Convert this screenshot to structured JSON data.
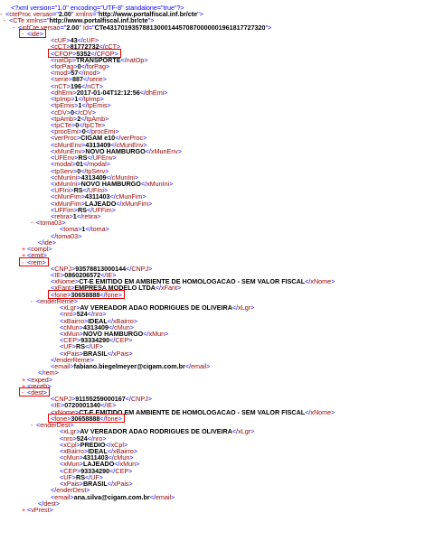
{
  "xml": {
    "lines": [
      {
        "k": "pi",
        "t": "<?xml version=\"1.0\" encoding=\"UTF-8\" standalone=\"true\"?>"
      },
      {
        "k": "open",
        "tog": "-",
        "name": "cteProc",
        "attrs": [
          [
            "versao",
            "2.00"
          ],
          [
            "xmlns",
            "http://www.portalfiscal.inf.br/cte"
          ]
        ]
      },
      {
        "k": "open",
        "tog": "-",
        "name": "CTe",
        "attrs": [
          [
            "xmlns",
            "http://www.portalfiscal.inf.br/cte"
          ]
        ]
      },
      {
        "k": "open",
        "tog": "-",
        "name": "infCte",
        "attrs": [
          [
            "versao",
            "2.00"
          ],
          [
            "Id",
            "CTe43170193578813000144570870000001961817727320"
          ]
        ]
      },
      {
        "k": "open",
        "tog": "-",
        "name": "ide"
      },
      {
        "k": "el",
        "name": "cUF",
        "v": "43"
      },
      {
        "k": "el",
        "name": "cCT",
        "v": "81772732"
      },
      {
        "k": "el",
        "name": "CFOP",
        "v": "5352"
      },
      {
        "k": "el",
        "name": "natOp",
        "v": "TRANSPORTE"
      },
      {
        "k": "el",
        "name": "forPag",
        "v": "0"
      },
      {
        "k": "el",
        "name": "mod",
        "v": "57"
      },
      {
        "k": "el",
        "name": "serie",
        "v": "887"
      },
      {
        "k": "el",
        "name": "nCT",
        "v": "196"
      },
      {
        "k": "el",
        "name": "dhEmi",
        "v": "2017-01-04T12:12:56"
      },
      {
        "k": "el",
        "name": "tpImp",
        "v": "1"
      },
      {
        "k": "el",
        "name": "tpEmis",
        "v": "1"
      },
      {
        "k": "el",
        "name": "cDV",
        "v": "0"
      },
      {
        "k": "el",
        "name": "tpAmb",
        "v": "2"
      },
      {
        "k": "el",
        "name": "tpCTe",
        "v": "0"
      },
      {
        "k": "el",
        "name": "procEmi",
        "v": "0"
      },
      {
        "k": "el",
        "name": "verProc",
        "v": "CIGAM e10"
      },
      {
        "k": "el",
        "name": "cMunEnv",
        "v": "4313409"
      },
      {
        "k": "el",
        "name": "xMunEnv",
        "v": "NOVO HAMBURGO"
      },
      {
        "k": "el",
        "name": "UFEnv",
        "v": "RS"
      },
      {
        "k": "el",
        "name": "modal",
        "v": "01"
      },
      {
        "k": "el",
        "name": "tpServ",
        "v": "0"
      },
      {
        "k": "el",
        "name": "cMunIni",
        "v": "4313409"
      },
      {
        "k": "el",
        "name": "xMunIni",
        "v": "NOVO HAMBURGO"
      },
      {
        "k": "el",
        "name": "UFIni",
        "v": "RS"
      },
      {
        "k": "el",
        "name": "cMunFim",
        "v": "4311403"
      },
      {
        "k": "el",
        "name": "xMunFim",
        "v": "LAJEADO"
      },
      {
        "k": "el",
        "name": "UFFim",
        "v": "RS"
      },
      {
        "k": "el",
        "name": "retira",
        "v": "1"
      },
      {
        "k": "open",
        "tog": "-",
        "name": "toma03"
      },
      {
        "k": "el",
        "name": "toma",
        "v": "1"
      },
      {
        "k": "close",
        "name": "toma03"
      },
      {
        "k": "close",
        "name": "ide"
      },
      {
        "k": "open",
        "tog": "+",
        "name": "compl"
      },
      {
        "k": "open",
        "tog": "+",
        "name": "emit"
      },
      {
        "k": "open",
        "tog": "-",
        "name": "rem"
      },
      {
        "k": "el",
        "name": "CNPJ",
        "v": "93578813000144"
      },
      {
        "k": "el",
        "name": "IE",
        "v": "0860206572"
      },
      {
        "k": "el",
        "name": "xNome",
        "v": "CT-E EMITIDO EM AMBIENTE DE HOMOLOGACAO - SEM VALOR FISCAL"
      },
      {
        "k": "el",
        "name": "xFant",
        "v": "EMPRESA MODELO LTDA"
      },
      {
        "k": "el",
        "name": "fone",
        "v": "30658888"
      },
      {
        "k": "open",
        "tog": "-",
        "name": "enderReme"
      },
      {
        "k": "el",
        "name": "xLgr",
        "v": "AV VEREADOR ADAO RODRIGUES DE OLIVEIRA"
      },
      {
        "k": "el",
        "name": "nro",
        "v": "524"
      },
      {
        "k": "el",
        "name": "xBairro",
        "v": "IDEAL"
      },
      {
        "k": "el",
        "name": "cMun",
        "v": "4313409"
      },
      {
        "k": "el",
        "name": "xMun",
        "v": "NOVO HAMBURGO"
      },
      {
        "k": "el",
        "name": "CEP",
        "v": "93334290"
      },
      {
        "k": "el",
        "name": "UF",
        "v": "RS"
      },
      {
        "k": "el",
        "name": "xPais",
        "v": "BRASIL"
      },
      {
        "k": "close",
        "name": "enderReme"
      },
      {
        "k": "el",
        "name": "email",
        "v": "fabiano.biegelmeyer@cigam.com.br"
      },
      {
        "k": "close",
        "name": "rem"
      },
      {
        "k": "open",
        "tog": "+",
        "name": "exped"
      },
      {
        "k": "open",
        "tog": "+",
        "name": "receb"
      },
      {
        "k": "open",
        "tog": "-",
        "name": "dest"
      },
      {
        "k": "el",
        "name": "CNPJ",
        "v": "91155259000167"
      },
      {
        "k": "el",
        "name": "IE",
        "v": "0720001340"
      },
      {
        "k": "el",
        "name": "xNome",
        "v": "CT-E EMITIDO EM AMBIENTE DE HOMOLOGACAO - SEM VALOR FISCAL"
      },
      {
        "k": "el",
        "name": "fone",
        "v": "30658888"
      },
      {
        "k": "open",
        "tog": "-",
        "name": "enderDest"
      },
      {
        "k": "el",
        "name": "xLgr",
        "v": "AV VEREADOR ADAO RODRIGUES DE OLIVEIRA"
      },
      {
        "k": "el",
        "name": "nro",
        "v": "524"
      },
      {
        "k": "el",
        "name": "xCpl",
        "v": "PREDIO"
      },
      {
        "k": "el",
        "name": "xBairro",
        "v": "IDEAL"
      },
      {
        "k": "el",
        "name": "cMun",
        "v": "4311403"
      },
      {
        "k": "el",
        "name": "xMun",
        "v": "LAJEADO"
      },
      {
        "k": "el",
        "name": "CEP",
        "v": "93334290"
      },
      {
        "k": "el",
        "name": "UF",
        "v": "RS"
      },
      {
        "k": "el",
        "name": "xPais",
        "v": "BRASIL"
      },
      {
        "k": "close",
        "name": "enderDest"
      },
      {
        "k": "el",
        "name": "email",
        "v": "ana.silva@cigam.com.br"
      },
      {
        "k": "close",
        "name": "dest"
      },
      {
        "k": "open",
        "tog": "+",
        "name": "vPrest"
      }
    ]
  },
  "highlights": [
    "ide",
    "CFOP",
    "rem",
    "fone",
    "dest",
    "fone"
  ],
  "colors": {
    "tag": "#990000",
    "punct": "#0000ff",
    "value": "#000000",
    "highlight": "#e00000",
    "toggle": "#ff0000"
  }
}
